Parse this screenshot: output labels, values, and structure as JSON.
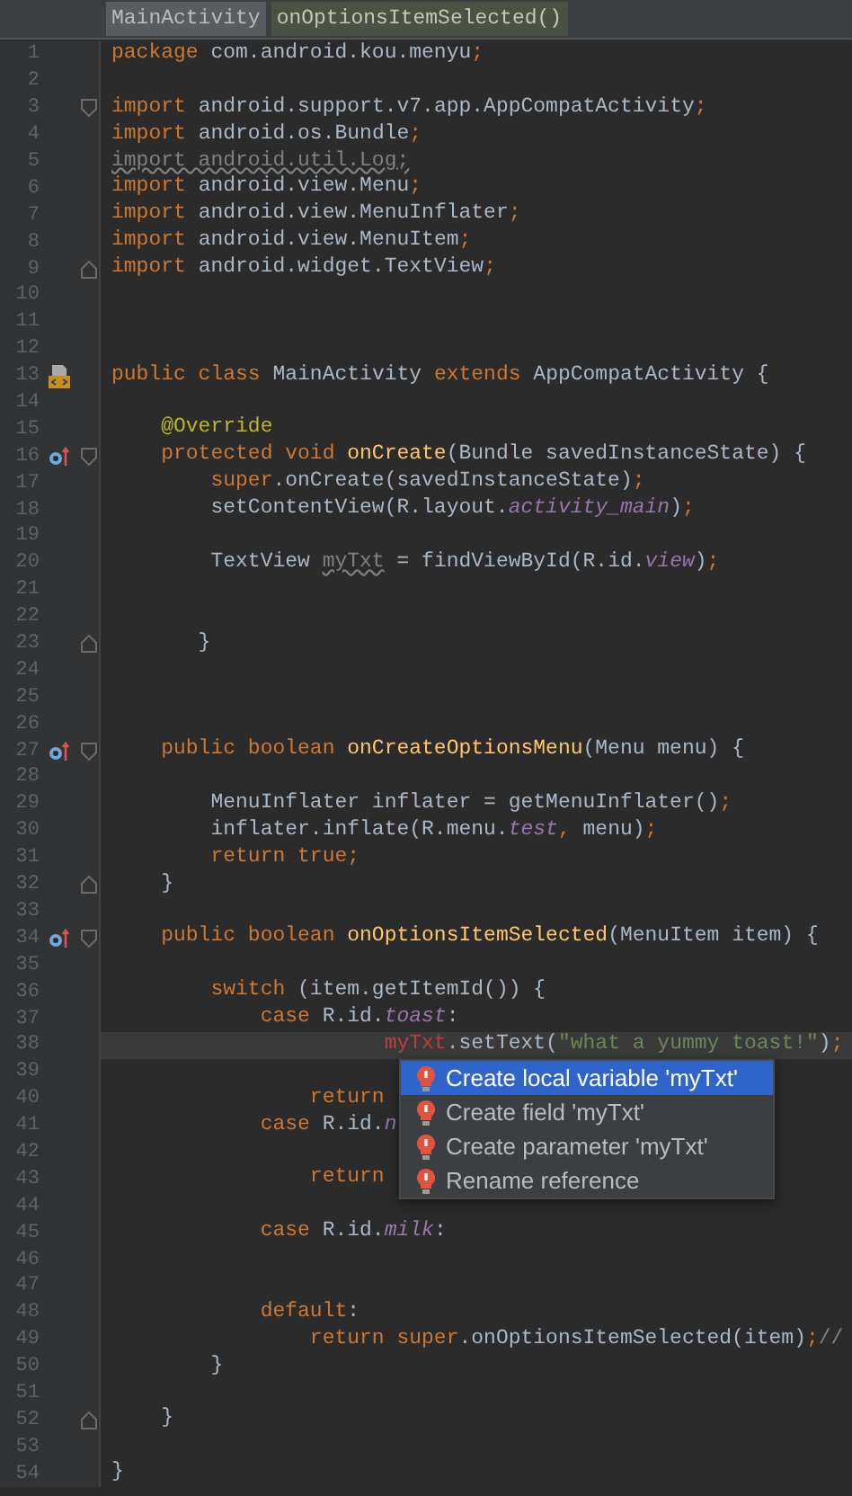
{
  "breadcrumbs": [
    {
      "label": "MainActivity",
      "selected": false
    },
    {
      "label": "onOptionsItemSelected()",
      "selected": true
    }
  ],
  "lines": [
    {
      "number": "1",
      "current": false,
      "tokens": [
        {
          "kind": "kw",
          "text": "package"
        },
        {
          "kind": "plain",
          "text": " com.android.kou.menyu"
        },
        {
          "kind": "kw",
          "text": ";"
        }
      ]
    },
    {
      "number": "2",
      "current": false
    },
    {
      "number": "3",
      "current": false,
      "fold_marker": {
        "kind": "start"
      },
      "tokens": [
        {
          "kind": "kw",
          "text": "import"
        },
        {
          "kind": "plain",
          "text": " android.support.v7.app.AppCompatActivity"
        },
        {
          "kind": "kw",
          "text": ";"
        }
      ]
    },
    {
      "number": "4",
      "current": false,
      "tokens": [
        {
          "kind": "kw",
          "text": "import"
        },
        {
          "kind": "plain",
          "text": " android.os.Bundle"
        },
        {
          "kind": "kw",
          "text": ";"
        }
      ]
    },
    {
      "number": "5",
      "current": false,
      "tokens": [
        {
          "kind": "unused",
          "text": "import android.util.Log;"
        }
      ]
    },
    {
      "number": "6",
      "current": false,
      "tokens": [
        {
          "kind": "kw",
          "text": "import"
        },
        {
          "kind": "plain",
          "text": " android.view.Menu"
        },
        {
          "kind": "kw",
          "text": ";"
        }
      ]
    },
    {
      "number": "7",
      "current": false,
      "tokens": [
        {
          "kind": "kw",
          "text": "import"
        },
        {
          "kind": "plain",
          "text": " android.view.MenuInflater"
        },
        {
          "kind": "kw",
          "text": ";"
        }
      ]
    },
    {
      "number": "8",
      "current": false,
      "tokens": [
        {
          "kind": "kw",
          "text": "import"
        },
        {
          "kind": "plain",
          "text": " android.view.MenuItem"
        },
        {
          "kind": "kw",
          "text": ";"
        }
      ]
    },
    {
      "number": "9",
      "current": false,
      "fold_marker": {
        "kind": "end"
      },
      "tokens": [
        {
          "kind": "kw",
          "text": "import"
        },
        {
          "kind": "plain",
          "text": " android.widget.TextView"
        },
        {
          "kind": "kw",
          "text": ";"
        }
      ]
    },
    {
      "number": "10",
      "current": false
    },
    {
      "number": "11",
      "current": false
    },
    {
      "number": "12",
      "current": false
    },
    {
      "number": "13",
      "current": false,
      "gutter_icon": {
        "kind": "class"
      },
      "tokens": [
        {
          "kind": "kw",
          "text": "public class"
        },
        {
          "kind": "plain",
          "text": " MainActivity "
        },
        {
          "kind": "kw",
          "text": "extends"
        },
        {
          "kind": "plain",
          "text": " AppCompatActivity {"
        }
      ]
    },
    {
      "number": "14",
      "current": false
    },
    {
      "number": "15",
      "current": false,
      "tokens": [
        {
          "kind": "annotation",
          "text": "    @Override"
        }
      ]
    },
    {
      "number": "16",
      "current": false,
      "gutter_icon": {
        "kind": "override"
      },
      "fold_marker": {
        "kind": "start"
      },
      "tokens": [
        {
          "kind": "kw",
          "text": "    protected void "
        },
        {
          "kind": "method",
          "text": "onCreate"
        },
        {
          "kind": "plain",
          "text": "(Bundle savedInstanceState) {"
        }
      ]
    },
    {
      "number": "17",
      "current": false,
      "tokens": [
        {
          "kind": "kw",
          "text": "        super"
        },
        {
          "kind": "plain",
          "text": ".onCreate(savedInstanceState)"
        },
        {
          "kind": "kw",
          "text": ";"
        }
      ]
    },
    {
      "number": "18",
      "current": false,
      "tokens": [
        {
          "kind": "plain",
          "text": "        setContentView(R.layout."
        },
        {
          "kind": "field",
          "text": "activity_main"
        },
        {
          "kind": "plain",
          "text": ")"
        },
        {
          "kind": "kw",
          "text": ";"
        }
      ]
    },
    {
      "number": "19",
      "current": false
    },
    {
      "number": "20",
      "current": false,
      "tokens": [
        {
          "kind": "plain",
          "text": "        TextView "
        },
        {
          "kind": "unused",
          "text": "myTxt"
        },
        {
          "kind": "plain",
          "text": " = findViewById(R.id."
        },
        {
          "kind": "field",
          "text": "view"
        },
        {
          "kind": "plain",
          "text": ")"
        },
        {
          "kind": "kw",
          "text": ";"
        }
      ]
    },
    {
      "number": "21",
      "current": false
    },
    {
      "number": "22",
      "current": false
    },
    {
      "number": "23",
      "current": false,
      "fold_marker": {
        "kind": "end"
      },
      "tokens": [
        {
          "kind": "plain",
          "text": "       }"
        }
      ]
    },
    {
      "number": "24",
      "current": false
    },
    {
      "number": "25",
      "current": false
    },
    {
      "number": "26",
      "current": false
    },
    {
      "number": "27",
      "current": false,
      "gutter_icon": {
        "kind": "override"
      },
      "fold_marker": {
        "kind": "start"
      },
      "tokens": [
        {
          "kind": "kw",
          "text": "    public boolean "
        },
        {
          "kind": "method",
          "text": "onCreateOptionsMenu"
        },
        {
          "kind": "plain",
          "text": "(Menu menu) {"
        }
      ]
    },
    {
      "number": "28",
      "current": false
    },
    {
      "number": "29",
      "current": false,
      "tokens": [
        {
          "kind": "plain",
          "text": "        MenuInflater inflater = getMenuInflater()"
        },
        {
          "kind": "kw",
          "text": ";"
        }
      ]
    },
    {
      "number": "30",
      "current": false,
      "tokens": [
        {
          "kind": "plain",
          "text": "        inflater.inflate(R.menu."
        },
        {
          "kind": "field",
          "text": "test"
        },
        {
          "kind": "kw",
          "text": ","
        },
        {
          "kind": "plain",
          "text": " menu)"
        },
        {
          "kind": "kw",
          "text": ";"
        }
      ]
    },
    {
      "number": "31",
      "current": false,
      "tokens": [
        {
          "kind": "kw",
          "text": "        return true;"
        }
      ]
    },
    {
      "number": "32",
      "current": false,
      "fold_marker": {
        "kind": "end"
      },
      "tokens": [
        {
          "kind": "plain",
          "text": "    }"
        }
      ]
    },
    {
      "number": "33",
      "current": false
    },
    {
      "number": "34",
      "current": false,
      "gutter_icon": {
        "kind": "override"
      },
      "fold_marker": {
        "kind": "start"
      },
      "tokens": [
        {
          "kind": "kw",
          "text": "    public boolean "
        },
        {
          "kind": "method",
          "text": "onOptionsItemSelected"
        },
        {
          "kind": "plain",
          "text": "(MenuItem item) {"
        }
      ]
    },
    {
      "number": "35",
      "current": false
    },
    {
      "number": "36",
      "current": false,
      "tokens": [
        {
          "kind": "kw",
          "text": "        switch"
        },
        {
          "kind": "plain",
          "text": " (item.getItemId()) {"
        }
      ]
    },
    {
      "number": "37",
      "current": false,
      "tokens": [
        {
          "kind": "kw",
          "text": "            case"
        },
        {
          "kind": "plain",
          "text": " R.id."
        },
        {
          "kind": "field",
          "text": "toast"
        },
        {
          "kind": "plain",
          "text": ":"
        }
      ]
    },
    {
      "number": "38",
      "current": true,
      "tokens": [
        {
          "kind": "error",
          "text": "                      myTxt"
        },
        {
          "kind": "plain",
          "text": ".setText("
        },
        {
          "kind": "string",
          "text": "\"what a yummy toast!\""
        },
        {
          "kind": "plain",
          "text": ")"
        },
        {
          "kind": "kw",
          "text": ";"
        }
      ]
    },
    {
      "number": "39",
      "current": false
    },
    {
      "number": "40",
      "current": false,
      "tokens": [
        {
          "kind": "kw",
          "text": "                return"
        }
      ]
    },
    {
      "number": "41",
      "current": false,
      "tokens": [
        {
          "kind": "kw",
          "text": "            case"
        },
        {
          "kind": "plain",
          "text": " R.id."
        },
        {
          "kind": "field",
          "text": "n"
        }
      ]
    },
    {
      "number": "42",
      "current": false
    },
    {
      "number": "43",
      "current": false,
      "tokens": [
        {
          "kind": "kw",
          "text": "                return"
        }
      ]
    },
    {
      "number": "44",
      "current": false
    },
    {
      "number": "45",
      "current": false,
      "tokens": [
        {
          "kind": "kw",
          "text": "            case"
        },
        {
          "kind": "plain",
          "text": " R.id."
        },
        {
          "kind": "field",
          "text": "milk"
        },
        {
          "kind": "plain",
          "text": ":"
        }
      ]
    },
    {
      "number": "46",
      "current": false
    },
    {
      "number": "47",
      "current": false
    },
    {
      "number": "48",
      "current": false,
      "tokens": [
        {
          "kind": "kw",
          "text": "            default"
        },
        {
          "kind": "plain",
          "text": ":"
        }
      ]
    },
    {
      "number": "49",
      "current": false,
      "tokens": [
        {
          "kind": "kw",
          "text": "                return super"
        },
        {
          "kind": "plain",
          "text": ".onOptionsItemSelected(item)"
        },
        {
          "kind": "kw",
          "text": ";"
        },
        {
          "kind": "comment",
          "text": "//"
        }
      ]
    },
    {
      "number": "50",
      "current": false,
      "tokens": [
        {
          "kind": "plain",
          "text": "        }"
        }
      ]
    },
    {
      "number": "51",
      "current": false
    },
    {
      "number": "52",
      "current": false,
      "fold_marker": {
        "kind": "end"
      },
      "tokens": [
        {
          "kind": "plain",
          "text": "    }"
        }
      ]
    },
    {
      "number": "53",
      "current": false
    },
    {
      "number": "54",
      "current": false,
      "tokens": [
        {
          "kind": "plain",
          "text": "}"
        }
      ]
    }
  ],
  "quick_fix_menu": [
    {
      "label": "Create local variable 'myTxt'",
      "selected": true
    },
    {
      "label": "Create field 'myTxt'",
      "selected": false
    },
    {
      "label": "Create parameter 'myTxt'",
      "selected": false
    },
    {
      "label": "Rename reference",
      "selected": false
    }
  ]
}
